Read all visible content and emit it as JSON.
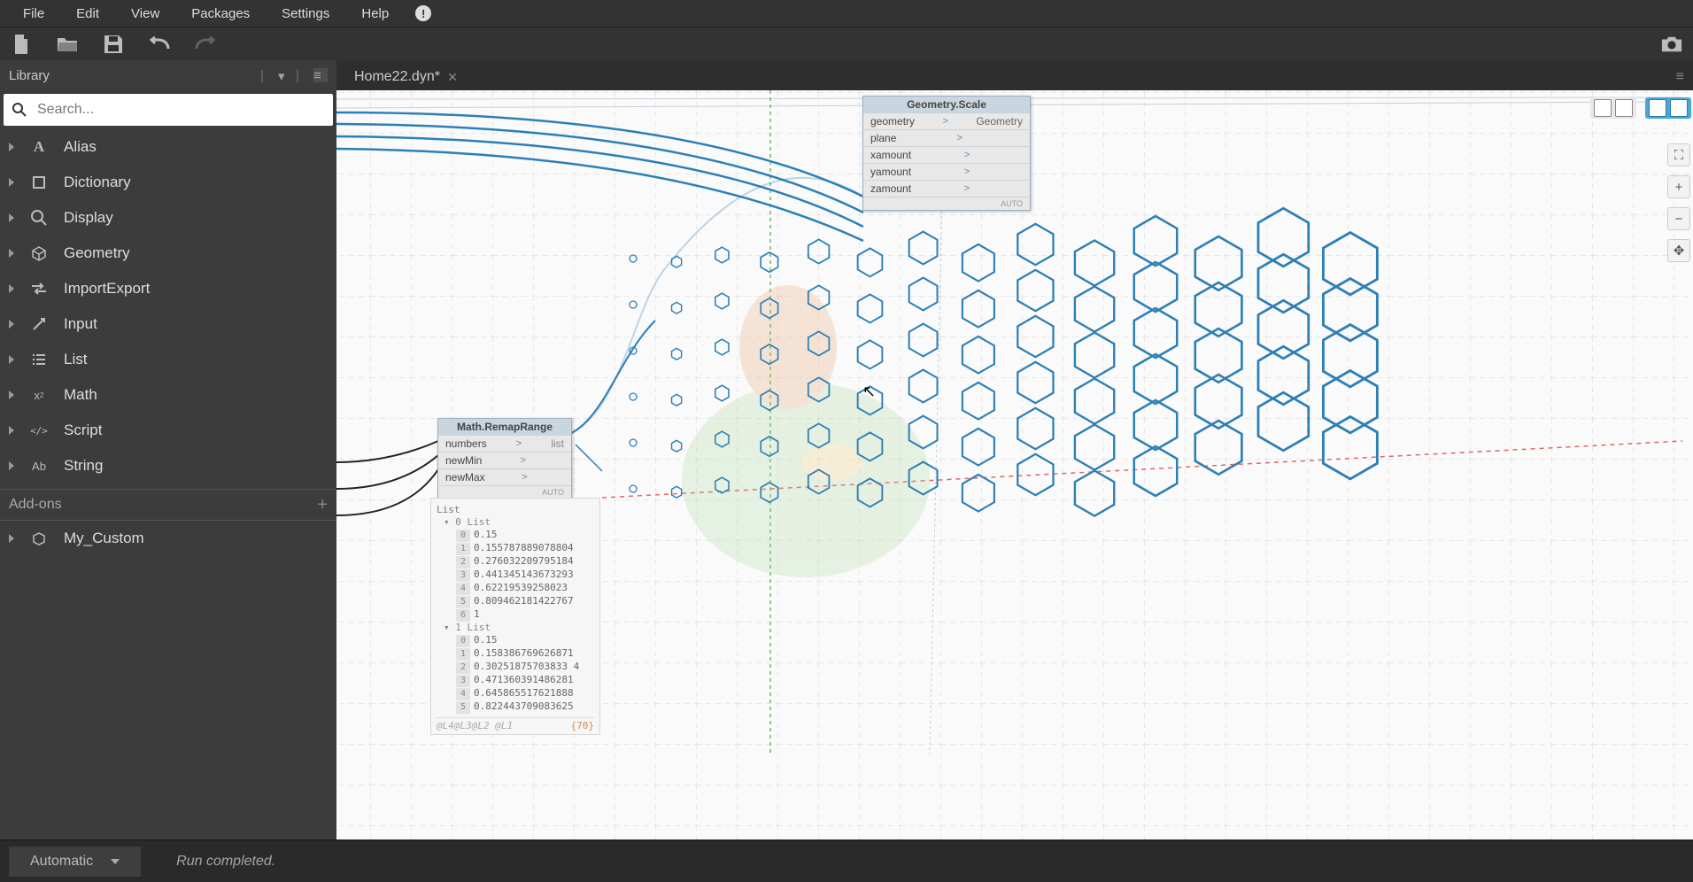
{
  "menu": {
    "items": [
      "File",
      "Edit",
      "View",
      "Packages",
      "Settings",
      "Help"
    ]
  },
  "library": {
    "title": "Library",
    "search_placeholder": "Search...",
    "categories": [
      "Alias",
      "Dictionary",
      "Display",
      "Geometry",
      "ImportExport",
      "Input",
      "List",
      "Math",
      "Script",
      "String"
    ],
    "addons_label": "Add-ons",
    "custom": "My_Custom"
  },
  "tab": {
    "name": "Home22.dyn*"
  },
  "node_remap": {
    "title": "Math.RemapRange",
    "inputs": [
      "numbers",
      "newMin",
      "newMax"
    ],
    "output": "list",
    "lacing": "AUTO"
  },
  "node_scale": {
    "title": "Geometry.Scale",
    "inputs": [
      "geometry",
      "plane",
      "xamount",
      "yamount",
      "zamount"
    ],
    "output": "Geometry",
    "lacing": "AUTO"
  },
  "preview": {
    "header": "List",
    "sub0": "0 List",
    "rows0": [
      "0.15",
      "0.155787889078804",
      "0.276032209795184",
      "0.441345143673293",
      "0.62219539258023",
      "0.809462181422767",
      "1"
    ],
    "sub1": "1 List",
    "rows1": [
      "0.15",
      "0.158386769626871",
      "0.30251875703833 4",
      "0.471360391486281",
      "0.645865517621888",
      "0.822443709083625"
    ],
    "footer_left": "@L4@L3@L2 @L1",
    "footer_right": "{70}"
  },
  "run": {
    "mode": "Automatic",
    "status": "Run completed."
  }
}
